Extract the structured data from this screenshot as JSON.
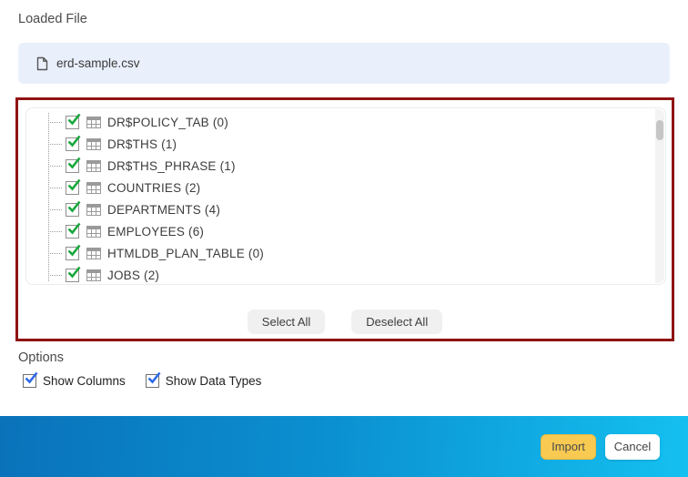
{
  "header": {
    "loaded_file_label": "Loaded File",
    "file_name": "erd-sample.csv"
  },
  "tree": {
    "items": [
      {
        "label": "DR$POLICY_TAB (0)",
        "name": "DR$POLICY_TAB",
        "count": 0,
        "checked": true
      },
      {
        "label": "DR$THS (1)",
        "name": "DR$THS",
        "count": 1,
        "checked": true
      },
      {
        "label": "DR$THS_PHRASE (1)",
        "name": "DR$THS_PHRASE",
        "count": 1,
        "checked": true
      },
      {
        "label": "COUNTRIES (2)",
        "name": "COUNTRIES",
        "count": 2,
        "checked": true
      },
      {
        "label": "DEPARTMENTS (4)",
        "name": "DEPARTMENTS",
        "count": 4,
        "checked": true
      },
      {
        "label": "EMPLOYEES (6)",
        "name": "EMPLOYEES",
        "count": 6,
        "checked": true
      },
      {
        "label": "HTMLDB_PLAN_TABLE (0)",
        "name": "HTMLDB_PLAN_TABLE",
        "count": 0,
        "checked": true
      },
      {
        "label": "JOBS (2)",
        "name": "JOBS",
        "count": 2,
        "checked": true
      }
    ]
  },
  "list_actions": {
    "select_all_label": "Select All",
    "deselect_all_label": "Deselect All"
  },
  "options": {
    "title": "Options",
    "checkboxes": [
      {
        "label": "Show Columns",
        "checked": true
      },
      {
        "label": "Show Data Types",
        "checked": true
      }
    ]
  },
  "footer": {
    "import_label": "Import",
    "cancel_label": "Cancel"
  },
  "colors": {
    "file_chip_bg": "#e9effb",
    "highlight_border": "#8f1412",
    "tree_check": "#18a73c",
    "option_check": "#2e6be6",
    "import_bg": "#f8ca52",
    "footer_gradient_start": "#0a72ba",
    "footer_gradient_end": "#14c0f0"
  }
}
